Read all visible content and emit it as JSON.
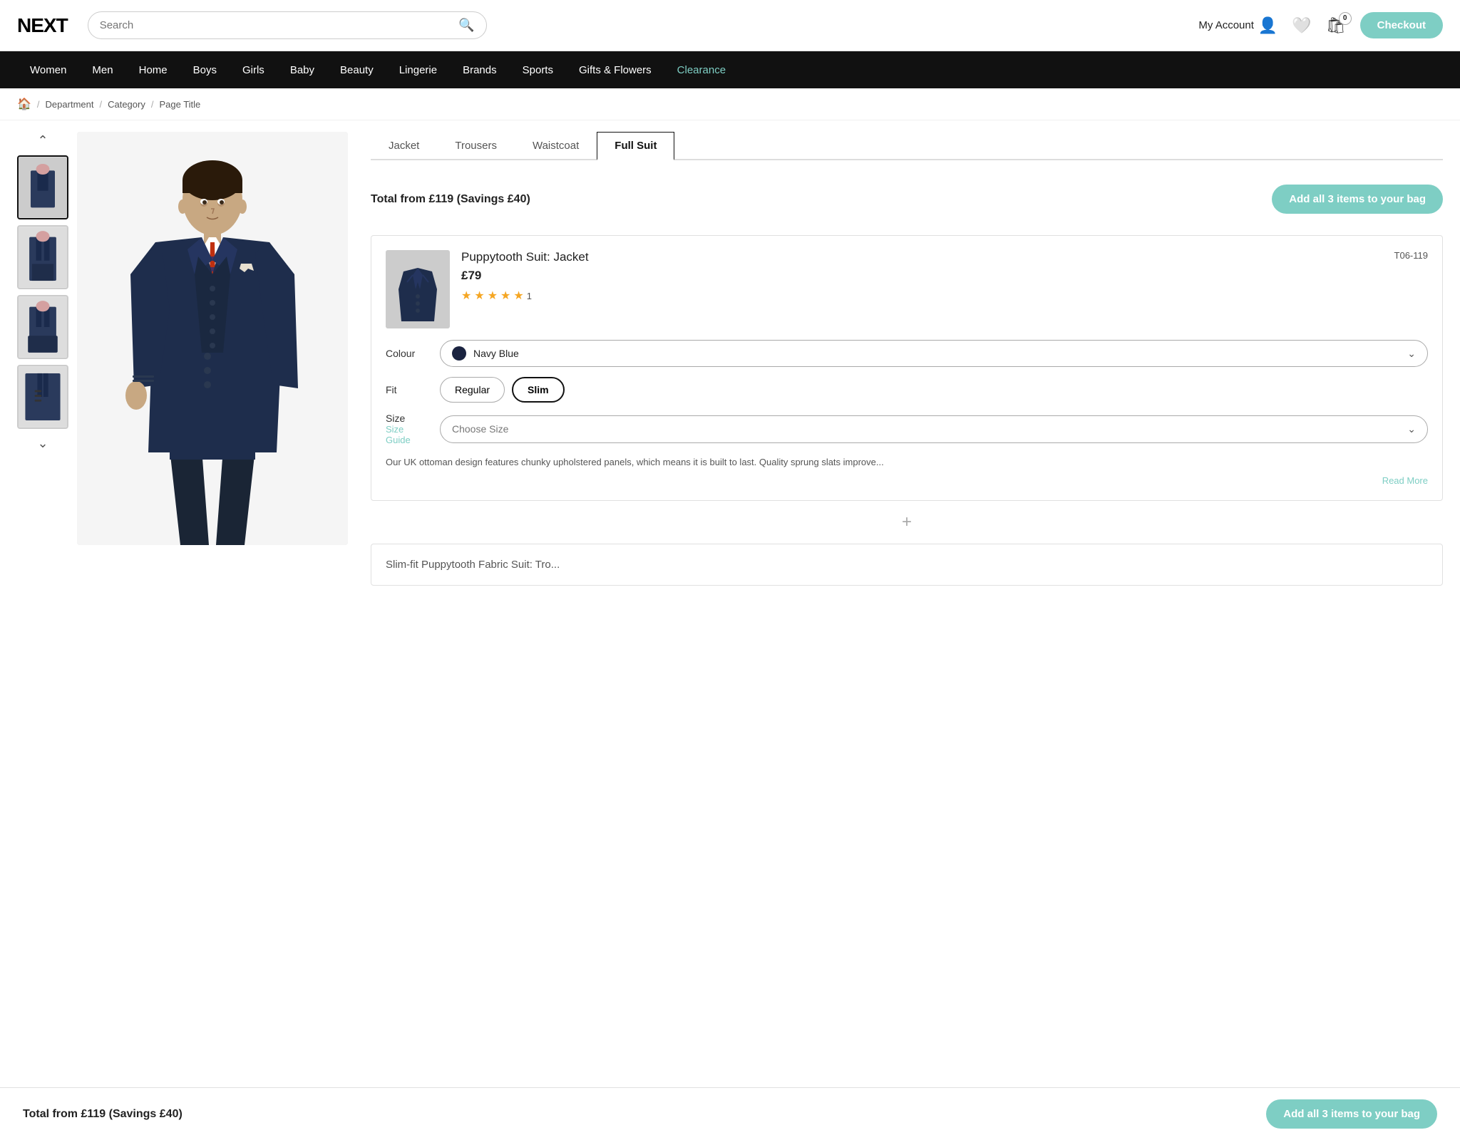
{
  "header": {
    "logo": "NEXT",
    "search_placeholder": "Search",
    "search_icon": "🔍",
    "my_account_label": "My Account",
    "bag_count": "0",
    "checkout_label": "Checkout"
  },
  "nav": {
    "items": [
      {
        "label": "Women",
        "id": "women",
        "clearance": false
      },
      {
        "label": "Men",
        "id": "men",
        "clearance": false
      },
      {
        "label": "Home",
        "id": "home",
        "clearance": false
      },
      {
        "label": "Boys",
        "id": "boys",
        "clearance": false
      },
      {
        "label": "Girls",
        "id": "girls",
        "clearance": false
      },
      {
        "label": "Baby",
        "id": "baby",
        "clearance": false
      },
      {
        "label": "Beauty",
        "id": "beauty",
        "clearance": false
      },
      {
        "label": "Lingerie",
        "id": "lingerie",
        "clearance": false
      },
      {
        "label": "Brands",
        "id": "brands",
        "clearance": false
      },
      {
        "label": "Sports",
        "id": "sports",
        "clearance": false
      },
      {
        "label": "Gifts & Flowers",
        "id": "gifts",
        "clearance": false
      },
      {
        "label": "Clearance",
        "id": "clearance",
        "clearance": true
      }
    ]
  },
  "breadcrumb": {
    "home_icon": "🏠",
    "items": [
      "Department",
      "Category",
      "Page Title"
    ]
  },
  "tabs": [
    {
      "label": "Jacket",
      "active": false
    },
    {
      "label": "Trousers",
      "active": false
    },
    {
      "label": "Waistcoat",
      "active": false
    },
    {
      "label": "Full Suit",
      "active": true
    }
  ],
  "total": {
    "text": "Total from £119 (Savings £40)",
    "add_all_label": "Add all 3 items to your bag"
  },
  "product": {
    "name": "Puppytooth Suit: Jacket",
    "price": "£79",
    "stars": 4.5,
    "star_count": 1,
    "product_code": "T06-119",
    "colour_label": "Colour",
    "colour_value": "Navy Blue",
    "fit_label": "Fit",
    "fit_options": [
      "Regular",
      "Slim"
    ],
    "fit_active": "Slim",
    "size_label": "Size",
    "size_guide_label": "Size Guide",
    "size_placeholder": "Choose Size",
    "description": "Our UK ottoman design features chunky upholstered panels, which means it is built to last. Quality sprung slats improve...",
    "read_more": "Read More"
  },
  "plus_separator": "+",
  "next_product_partial": "Slim-fit Puppytooth Fabric Suit: Tro...",
  "sticky_footer": {
    "text": "Total from £119 (Savings £40)",
    "add_all_label": "Add all 3 items to your bag"
  },
  "thumbnails": [
    {
      "alt": "Main suit view",
      "active": true
    },
    {
      "alt": "Full suit standing",
      "active": false
    },
    {
      "alt": "Suit sitting",
      "active": false
    },
    {
      "alt": "Suit detail",
      "active": false
    }
  ]
}
